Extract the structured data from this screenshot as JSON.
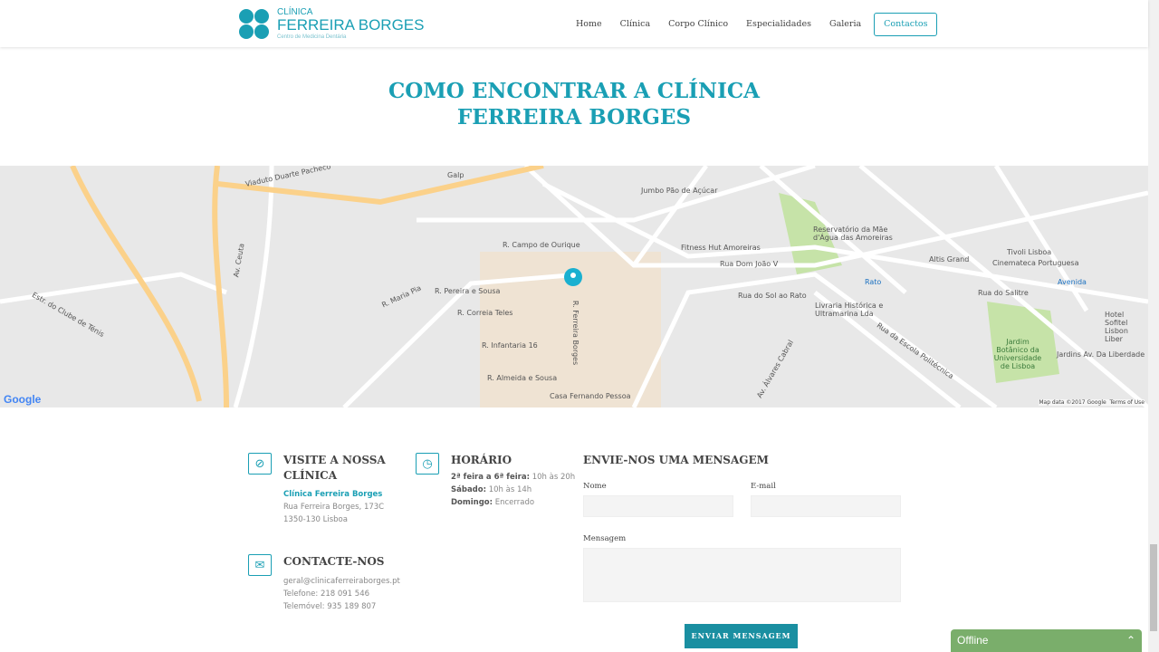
{
  "header": {
    "logo": {
      "line1": "CLÍNICA",
      "line2": "FERREIRA BORGES",
      "line3": "Centro de Medicina Dentária"
    },
    "nav": [
      "Home",
      "Clínica",
      "Corpo Clínico",
      "Especialidades",
      "Galeria"
    ],
    "contact_button": "Contactos"
  },
  "page_title": {
    "line1": "COMO ENCONTRAR A CLÍNICA",
    "line2": "FERREIRA BORGES"
  },
  "map": {
    "labels": [
      "Viaduto Duarte Pacheco",
      "Galp",
      "Jumbo Pão de Açúcar",
      "R. Campo de Ourique",
      "Fitness Hut Amoreiras",
      "Reservatório da Mãe d'Água das Amoreiras",
      "Rua Dom João V",
      "Rua do Sol ao Rato",
      "Rato",
      "Livraria Histórica e Ultramarina Lda",
      "Altis Grand",
      "Tivoli Lisboa",
      "Cinemateca Portuguesa",
      "Rua do Salitre",
      "Avenida",
      "Hotel Sofitel Lisbon Liber",
      "Jardim Botânico da Universidade de Lisboa",
      "Jardins Av. Da Liberdade",
      "R. Pereira e Sousa",
      "R. Correia Teles",
      "R. Infantaria 16",
      "R. Almeida e Sousa",
      "Casa Fernando Pessoa",
      "R. Ferreira Borges",
      "Rua da Escola Politécnica",
      "Av. Álvares Cabral",
      "R. Maria Pia",
      "Av. Ceuta",
      "Estr. do Clube de Ténis"
    ],
    "attribution": "Map data ©2017 Google",
    "terms": "Terms of Use",
    "google": "Google"
  },
  "visit": {
    "title": "VISITE A NOSSA CLÍNICA",
    "name": "Clínica Ferreira Borges",
    "address1": "Rua Ferreira Borges, 173C",
    "address2": "1350-130 Lisboa"
  },
  "hours": {
    "title": "HORÁRIO",
    "rows": [
      {
        "day": "2ª feira a 6ª feira:",
        "time": "10h às 20h"
      },
      {
        "day": "Sábado:",
        "time": "10h às 14h"
      },
      {
        "day": "Domingo:",
        "time": "Encerrado"
      }
    ]
  },
  "contact": {
    "title": "CONTACTE-NOS",
    "email": "geral@clinicaferreiraborges.pt",
    "phone": "Telefone: 218 091 546",
    "mobile": "Telemóvel: 935 189 807"
  },
  "form": {
    "title": "ENVIE-NOS UMA MENSAGEM",
    "name_label": "Nome",
    "email_label": "E-mail",
    "message_label": "Mensagem",
    "submit": "ENVIAR MENSAGEM"
  },
  "chat": {
    "status": "Offline"
  },
  "colors": {
    "accent": "#1a9fb4",
    "chat": "#7aae6b"
  }
}
